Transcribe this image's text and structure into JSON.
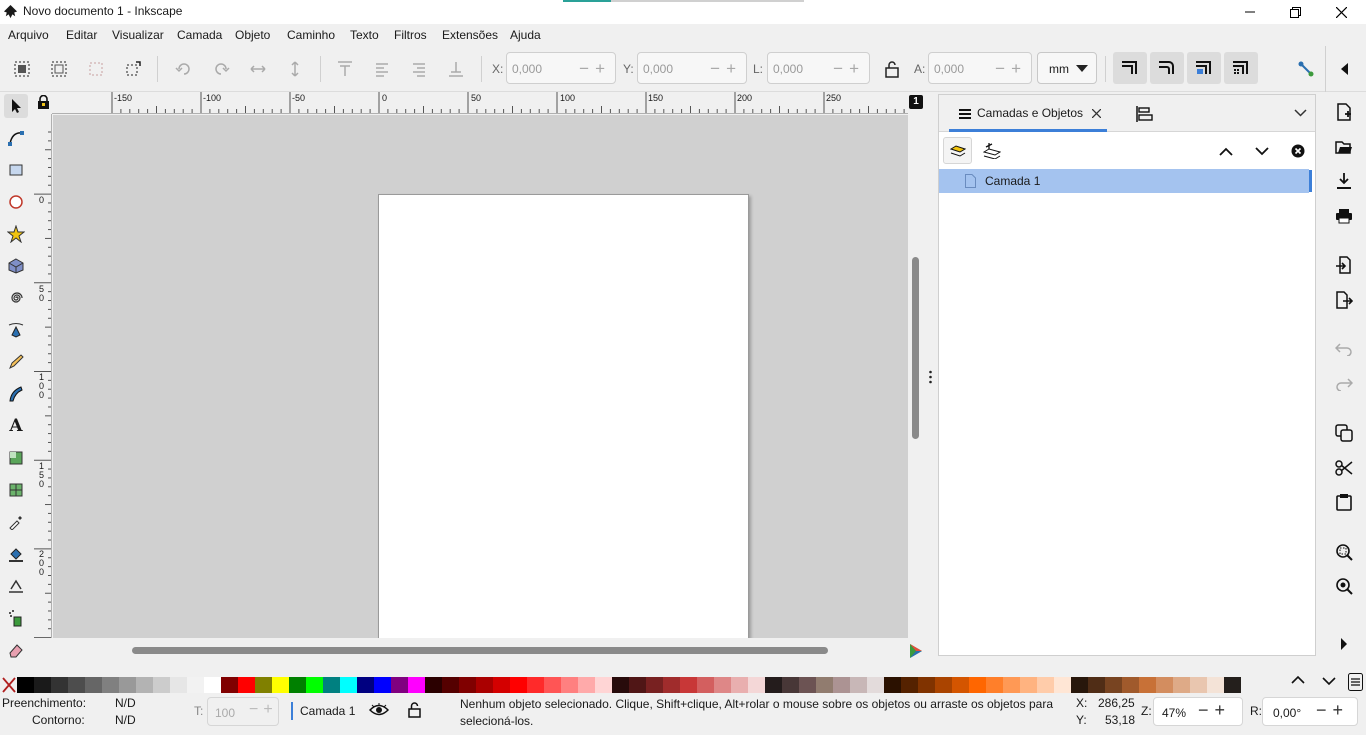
{
  "window": {
    "title": "Novo documento 1 - Inkscape",
    "controls": [
      "minimize",
      "maximize",
      "close"
    ]
  },
  "menu": [
    "Arquivo",
    "Editar",
    "Visualizar",
    "Camada",
    "Objeto",
    "Caminho",
    "Texto",
    "Filtros",
    "Extensões",
    "Ajuda"
  ],
  "toolbar": {
    "x": {
      "label": "X:",
      "value": "0,000"
    },
    "y": {
      "label": "Y:",
      "value": "0,000"
    },
    "w": {
      "label": "L:",
      "value": "0,000"
    },
    "h": {
      "label": "A:",
      "value": "0,000"
    },
    "unit": "mm"
  },
  "ruler": {
    "h_labels": [
      "-150",
      "-100",
      "-50",
      "0",
      "50",
      "100",
      "150",
      "200",
      "250"
    ],
    "v_labels": [
      "0",
      "5\n0",
      "1\n0\n0",
      "1\n5\n0",
      "2\n0\n0"
    ]
  },
  "page_badge": "1",
  "panel": {
    "tab_label": "Camadas e Objetos",
    "layer_name": "Camada 1"
  },
  "palette": {
    "colors": [
      "#000000",
      "#1a1a1a",
      "#333333",
      "#4d4d4d",
      "#666666",
      "#808080",
      "#999999",
      "#b3b3b3",
      "#cccccc",
      "#e6e6e6",
      "#f2f2f2",
      "#ffffff",
      "#800000",
      "#ff0000",
      "#808000",
      "#ffff00",
      "#008000",
      "#00ff00",
      "#008080",
      "#00ffff",
      "#000080",
      "#0000ff",
      "#800080",
      "#ff00ff",
      "#2b0000",
      "#550000",
      "#800000",
      "#aa0000",
      "#d40000",
      "#ff0000",
      "#ff2a2a",
      "#ff5555",
      "#ff8080",
      "#ffaaaa",
      "#ffd5d5",
      "#280b0b",
      "#501616",
      "#782121",
      "#a02c2c",
      "#c83737",
      "#d35f5f",
      "#de8787",
      "#e9afaf",
      "#f4d7d7",
      "#241c1c",
      "#483737",
      "#6c5353",
      "#917c6f",
      "#ac9393",
      "#c8b7b7",
      "#e3dbdb",
      "#2b1100",
      "#552200",
      "#803300",
      "#aa4400",
      "#d45500",
      "#ff6600",
      "#ff7f2a",
      "#ff9955",
      "#ffb380",
      "#ffccaa",
      "#ffe6d5",
      "#28170b",
      "#502d16",
      "#784421",
      "#a05a2c",
      "#c87137",
      "#d38d5f",
      "#deaa87",
      "#e9c6af",
      "#f4e3d7",
      "#241f1c"
    ]
  },
  "status": {
    "fill_label": "Preenchimento:",
    "fill_value": "N/D",
    "stroke_label": "Contorno:",
    "stroke_value": "N/D",
    "opacity_label": "T:",
    "opacity_value": "100",
    "layer": "Camada 1",
    "message": "Nenhum objeto selecionado. Clique, Shift+clique, Alt+rolar o mouse sobre os objetos ou arraste os objetos para selecioná-los.",
    "x_label": "X:",
    "x_value": "286,25",
    "y_label": "Y:",
    "y_value": "53,18",
    "zoom_label": "Z:",
    "zoom_value": "47%",
    "rotate_label": "R:",
    "rotate_value": "0,00°"
  }
}
